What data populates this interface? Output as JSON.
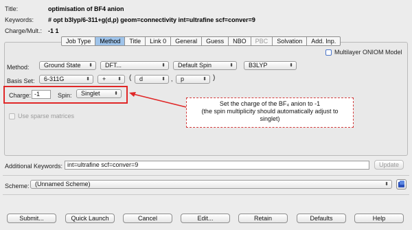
{
  "header": {
    "title_label": "Title:",
    "title_value": "optimisation of BF4 anion",
    "keywords_label": "Keywords:",
    "keywords_value": "# opt b3lyp/6-311+g(d,p) geom=connectivity int=ultrafine scf=conver=9",
    "charge_mult_label": "Charge/Mult.:",
    "charge_mult_value": "-1 1"
  },
  "tabs": [
    {
      "label": "Job Type",
      "active": false
    },
    {
      "label": "Method",
      "active": true
    },
    {
      "label": "Title",
      "active": false
    },
    {
      "label": "Link 0",
      "active": false
    },
    {
      "label": "General",
      "active": false
    },
    {
      "label": "Guess",
      "active": false
    },
    {
      "label": "NBO",
      "active": false
    },
    {
      "label": "PBC",
      "active": false,
      "disabled": true
    },
    {
      "label": "Solvation",
      "active": false
    },
    {
      "label": "Add. Inp.",
      "active": false
    }
  ],
  "method_panel": {
    "oniom_label": "Multilayer ONIOM Model",
    "method_label": "Method:",
    "state_select": "Ground State",
    "type_select": "DFT...",
    "spin_select": "Default Spin",
    "functional_select": "B3LYP",
    "basis_label": "Basis Set:",
    "basis_select": "6-311G",
    "diffuse_select": "+",
    "paren_open": "(",
    "pol1_select": "d",
    "comma": ",",
    "pol2_select": "p",
    "paren_close": ")",
    "charge_label": "Charge:",
    "charge_value": "-1",
    "spin_label": "Spin:",
    "spin_value": "Singlet",
    "sparse_label": "Use sparse matrices"
  },
  "annotation": {
    "line1": "Set the charge of the BF₄ anion to -1",
    "line2": "(the spin multiplicity should automatically adjust to",
    "line3": "singlet)",
    "color": "#e02626"
  },
  "additional": {
    "label": "Additional Keywords:",
    "value": "int=ultrafine scf=conver=9",
    "update_button": "Update"
  },
  "scheme": {
    "label": "Scheme:",
    "value": "(Unnamed Scheme)"
  },
  "buttons": {
    "submit": "Submit...",
    "quick_launch": "Quick Launch",
    "cancel": "Cancel",
    "edit": "Edit...",
    "retain": "Retain",
    "defaults": "Defaults",
    "help": "Help"
  },
  "colors": {
    "active_tab": "#9ec3ea",
    "highlight": "#e02626"
  }
}
